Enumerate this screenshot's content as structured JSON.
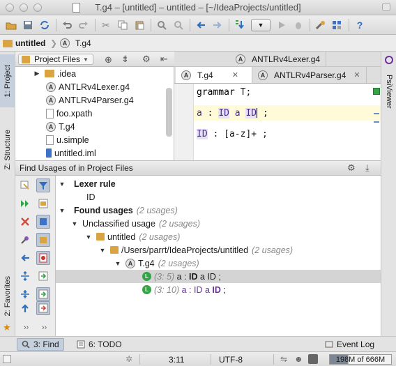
{
  "window": {
    "title": "T.g4 – [untitled] – untitled – [~/IdeaProjects/untitled]"
  },
  "navbar": {
    "crumbs": [
      "untitled",
      "T.g4"
    ]
  },
  "left_strip": {
    "tabs": [
      "1: Project",
      "Z: Structure",
      "2: Favorites"
    ]
  },
  "right_strip": {
    "tabs": [
      "PsiViewer"
    ]
  },
  "project_panel": {
    "view_selector": "Project Files",
    "items": [
      ".idea",
      "ANTLRv4Lexer.g4",
      "ANTLRv4Parser.g4",
      "foo.xpath",
      "T.g4",
      "u.simple",
      "untitled.iml"
    ]
  },
  "editor": {
    "tabs_row1": [
      "ANTLRv4Lexer.g4"
    ],
    "tabs_row2": [
      "T.g4",
      "ANTLRv4Parser.g4"
    ],
    "lines": [
      {
        "kw": "grammar",
        "name": "T",
        "end": ";"
      },
      {
        "a": "a",
        "colon": ":",
        "t1": "ID",
        "t2": "a",
        "t3": "ID",
        "end": ";"
      },
      {
        "a": "ID",
        "colon": ":",
        "body": "[a-z]+",
        "end": ";"
      }
    ]
  },
  "find": {
    "header_prefix": "Find Usages of",
    "header_suffix": "in Project Files",
    "tree": {
      "lexer_rule": "Lexer rule",
      "id": "ID",
      "found": "Found usages",
      "found_count": "(2 usages)",
      "unclassified": "Unclassified usage",
      "unclassified_count": "(2 usages)",
      "project": "untitled",
      "project_count": "(2 usages)",
      "path": "/Users/parrt/IdeaProjects/untitled",
      "path_count": "(2 usages)",
      "file": "T.g4",
      "file_count": "(2 usages)",
      "usages": [
        {
          "pos": "(3: 5)",
          "pre": "a : ",
          "match": "ID",
          "post": " a ID ;"
        },
        {
          "pos": "(3: 10)",
          "pre": "a : ID a ",
          "match": "ID",
          "post": " ;"
        }
      ]
    }
  },
  "bottom_tabs": {
    "find": "3: Find",
    "todo": "6: TODO",
    "event_log": "Event Log"
  },
  "status": {
    "position": "3:11",
    "encoding": "UTF-8",
    "memory": "198M of 666M",
    "memory_used_fraction": 0.3
  }
}
